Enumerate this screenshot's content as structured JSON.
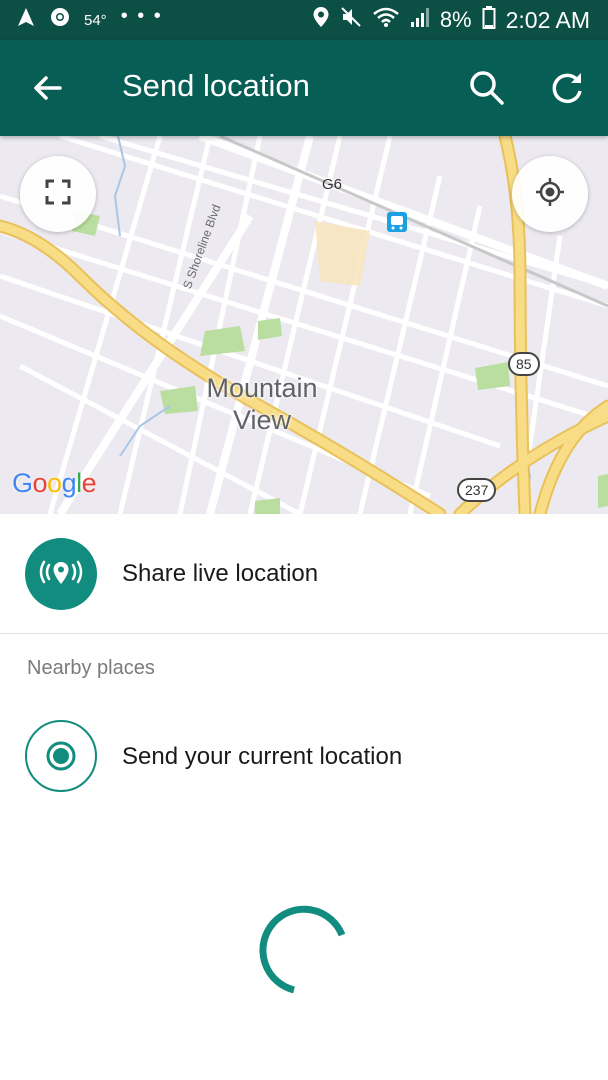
{
  "status_bar": {
    "temperature": "54°",
    "dots": "• • •",
    "battery_percent": "8%",
    "time": "2:02 AM",
    "icons": [
      "navigation-icon",
      "chrome-icon",
      "location-icon",
      "mute-icon",
      "wifi-icon",
      "signal-icon",
      "battery-icon"
    ]
  },
  "app_bar": {
    "title": "Send location",
    "icons": [
      "back-arrow-icon",
      "search-icon",
      "refresh-icon"
    ]
  },
  "map": {
    "city_line1": "Mountain",
    "city_line2": "View",
    "street_label": "S Shoreline Blvd",
    "road_label_g6": "G6",
    "route_85": "85",
    "route_237": "237",
    "logo": {
      "g1": "G",
      "o1": "o",
      "o2": "o",
      "g2": "g",
      "l": "l",
      "e": "e"
    },
    "logo_colors": [
      "#4285f4",
      "#ea4335",
      "#fbbc05",
      "#4285f4",
      "#34a853",
      "#ea4335"
    ],
    "icons": [
      "fullscreen-icon",
      "my-location-icon",
      "train-station-icon"
    ]
  },
  "share_live": {
    "label": "Share live location",
    "icon": "live-location-icon"
  },
  "nearby": {
    "header": "Nearby places",
    "current_location_label": "Send your current location",
    "icon": "current-location-icon"
  },
  "colors": {
    "status_bar": "#0b4f45",
    "app_bar": "#075e54",
    "accent": "#128c7e",
    "map_bg": "#eceaf0",
    "road_major": "#f6d77a",
    "park": "#b9dea0"
  }
}
